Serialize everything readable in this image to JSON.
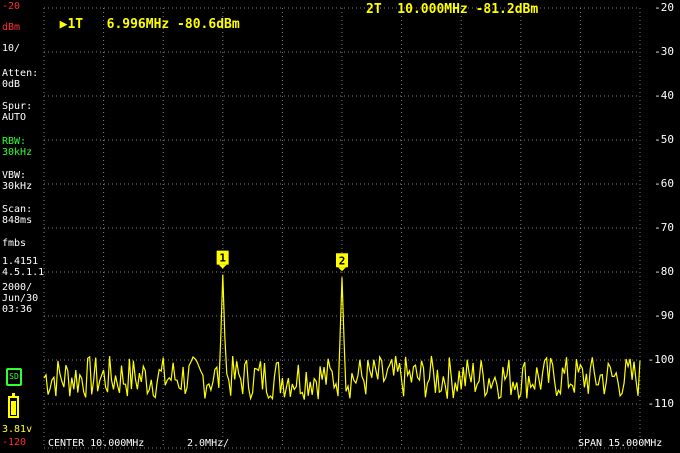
{
  "sidebar": {
    "ref_level": "-20",
    "unit": "dBm",
    "scale": "10/",
    "atten_label": "Atten:",
    "atten_value": "0dB",
    "spur_label": "Spur:",
    "spur_value": "AUTO",
    "rbw_label": "RBW:",
    "rbw_value": "30kHz",
    "vbw_label": "VBW:",
    "vbw_value": "30kHz",
    "scan_label": "Scan:",
    "scan_value": "848ms",
    "firmware_1": "fmbs",
    "firmware_2": "1.4151",
    "firmware_3": "4.5.1.1",
    "date_1": "2000/",
    "date_2": "Jun/30",
    "time": "03:36",
    "sd_label": "SD",
    "battery": "3.81v",
    "bottom_level": "-120"
  },
  "markers": {
    "m1_text": "1T   6.996MHz -80.6dBm",
    "m2_text": "2T  10.000MHz -81.2dBm",
    "m1_label": "1",
    "m2_label": "2"
  },
  "y_axis": {
    "labels": [
      "-20",
      "-30",
      "-40",
      "-50",
      "-60",
      "-70",
      "-80",
      "-90",
      "-100",
      "-110"
    ]
  },
  "footer": {
    "center": "CENTER 10.000MHz",
    "per_div": "2.0MHz/",
    "span": "SPAN 15.000MHz"
  },
  "colors": {
    "trace": "#ffff00",
    "grid": "#808080",
    "background": "#000000"
  },
  "chart_data": {
    "type": "line",
    "x_unit": "MHz",
    "y_unit": "dBm",
    "xlim": [
      2.5,
      17.5
    ],
    "ylim": [
      -120,
      -20
    ],
    "noise_floor_dbm": -104,
    "peaks": [
      {
        "label": "1",
        "freq_mhz": 6.996,
        "level_dbm": -80.6
      },
      {
        "label": "2",
        "freq_mhz": 10.0,
        "level_dbm": -81.2
      }
    ]
  }
}
